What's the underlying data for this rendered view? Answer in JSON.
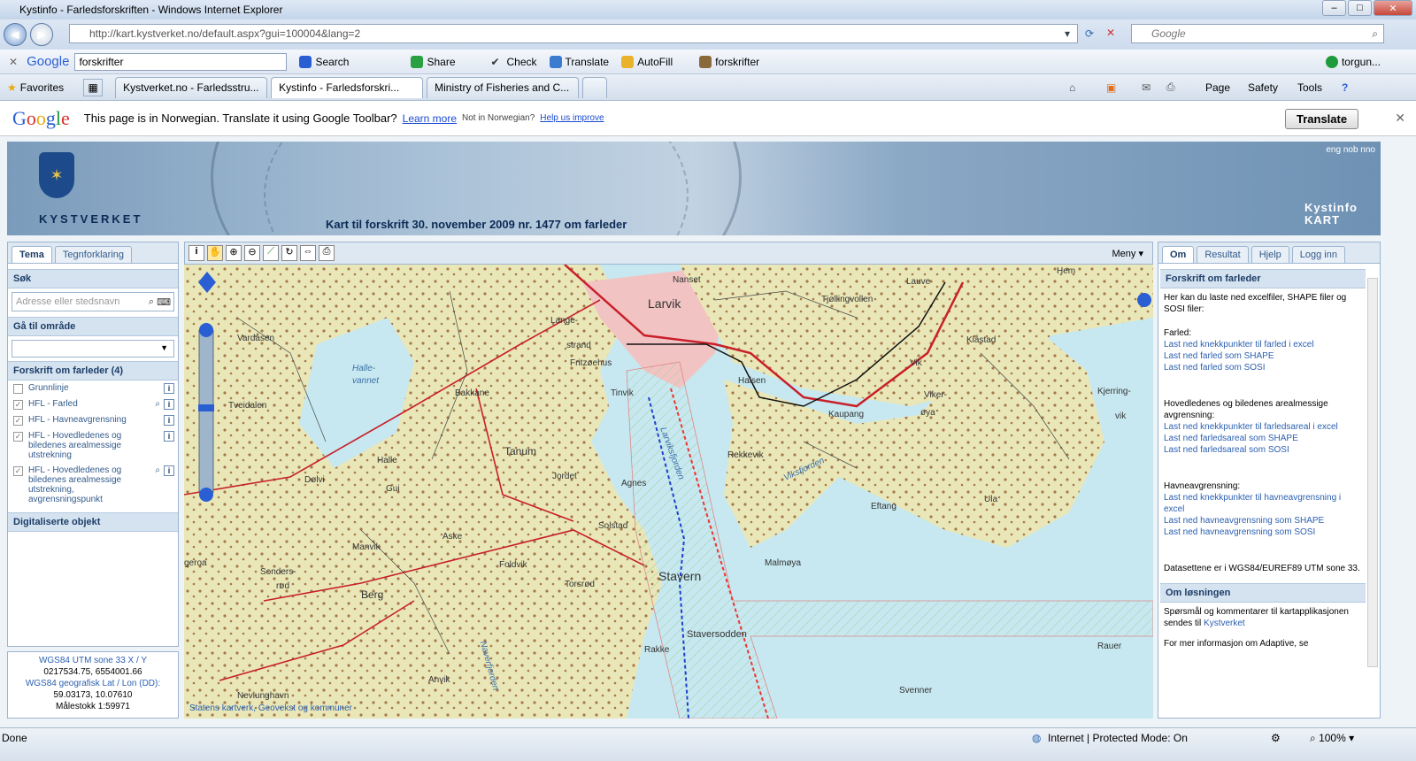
{
  "window": {
    "title": "Kystinfo - Farledsforskriften - Windows Internet Explorer"
  },
  "address": {
    "url": "http://kart.kystverket.no/default.aspx?gui=100004&lang=2",
    "search_placeholder": "Google"
  },
  "gtoolbar": {
    "brand": "Google",
    "query": "forskrifter",
    "search": "Search",
    "share": "Share",
    "check": "Check",
    "translate": "Translate",
    "autofill": "AutoFill",
    "saved": "forskrifter",
    "user": "torgun..."
  },
  "favbar": {
    "favorites": "Favorites",
    "tabs": [
      "Kystverket.no - Farledsstru...",
      "Kystinfo - Farledsforskri...",
      "Ministry of Fisheries and C..."
    ],
    "page": "Page",
    "safety": "Safety",
    "tools": "Tools"
  },
  "translatebar": {
    "message": "This page is in Norwegian.  Translate it using Google Toolbar?",
    "learn": "Learn more",
    "not": "Not in Norwegian?",
    "help": "Help us improve",
    "button": "Translate"
  },
  "banner": {
    "org": "KYSTVERKET",
    "title": "Kart til forskrift 30. november 2009 nr. 1477 om farleder",
    "lang": "eng nob nno",
    "app1": "Kystinfo",
    "app2": "KART"
  },
  "left": {
    "tabs": [
      "Tema",
      "Tegnforklaring"
    ],
    "search_title": "Søk",
    "search_placeholder": "Adresse eller stedsnavn",
    "goto": "Gå til område",
    "group": "Forskrift om farleder (4)",
    "layers": [
      "Grunnlinje",
      "HFL - Farled",
      "HFL - Havneavgrensning",
      "HFL - Hovedledenes og biledenes arealmessige utstrekning",
      "HFL - Hovedledenes og biledenes arealmessige utstrekning, avgrensningspunkt"
    ],
    "digital": "Digitaliserte objekt",
    "coord": {
      "utm_label": "WGS84 UTM sone 33 X / Y",
      "utm": "0217534.75, 6554001.66",
      "geo_label": "WGS84 geografisk Lat / Lon (DD):",
      "geo": "59.03173, 10.07610",
      "scale": "Målestokk 1:59971"
    }
  },
  "map": {
    "menu": "Meny",
    "credit_a": "Statens kartverk",
    "credit_b": "Geovekst",
    "credit_c": "og",
    "credit_d": "kommuner",
    "places": [
      "Larvik",
      "Nanset",
      "Tjøllingvollen",
      "Lauve",
      "Hem",
      "Vardåsen",
      "Halle-",
      "vannet",
      "Lange-",
      "strand",
      "Fritzøehus",
      "Tinvik",
      "Halsen",
      "Klåstad",
      "Vik",
      "Viker-",
      "øya",
      "Kjerring-",
      "vik",
      "Bakkane",
      "Tveidalen",
      "Tanum",
      "Kaupang",
      "Rekkevik",
      "Viksfjorden",
      "Halle",
      "Jordet",
      "Agnes",
      "Dølvi",
      "Gui",
      "Eftang",
      "Ula",
      "Solstad",
      "Aske",
      "Manvik",
      "Foldvik",
      "Malmøya",
      "Sonders-",
      "rød",
      "Berg",
      "Torsrød",
      "Stavern",
      "Staversodden",
      "Rakke",
      "Rauer",
      "Nevlunghavn",
      "Anvik",
      "Svenner",
      "Naverfjorden",
      "Larviksfjorden",
      "geroa"
    ]
  },
  "right": {
    "tabs": [
      "Om",
      "Resultat",
      "Hjelp",
      "Logg inn"
    ],
    "section": "Forskrift om farleder",
    "intro": "Her kan du laste ned excelfiler, SHAPE filer og SOSI filer:",
    "farled": "Farled:",
    "farled_links": [
      "Last ned knekkpunkter til farled i excel",
      "Last ned farled som SHAPE",
      "Last ned farled som SOSI"
    ],
    "hoved": "Hovedledenes og biledenes arealmessige avgrensning:",
    "hoved_links": [
      "Last ned knekkpunkter til farledsareal i excel",
      "Last ned farledsareal som SHAPE",
      "Last ned farledsareal som SOSI"
    ],
    "havn": "Havneavgrensning:",
    "havn_links": [
      "Last ned knekkpunkter til havneavgrensning i excel",
      "Last ned havneavgrensning som SHAPE",
      "Last ned havneavgrensning som SOSI"
    ],
    "datum": "Datasettene er i WGS84/EUREF89 UTM sone 33.",
    "about": "Om løsningen",
    "about_text": "Spørsmål og kommentarer til kartapplikasjonen sendes til",
    "about_link": "Kystverket",
    "more": "For mer informasjon om Adaptive, se"
  },
  "status": {
    "done": "Done",
    "zone": "Internet | Protected Mode: On",
    "zoom": "100%"
  }
}
